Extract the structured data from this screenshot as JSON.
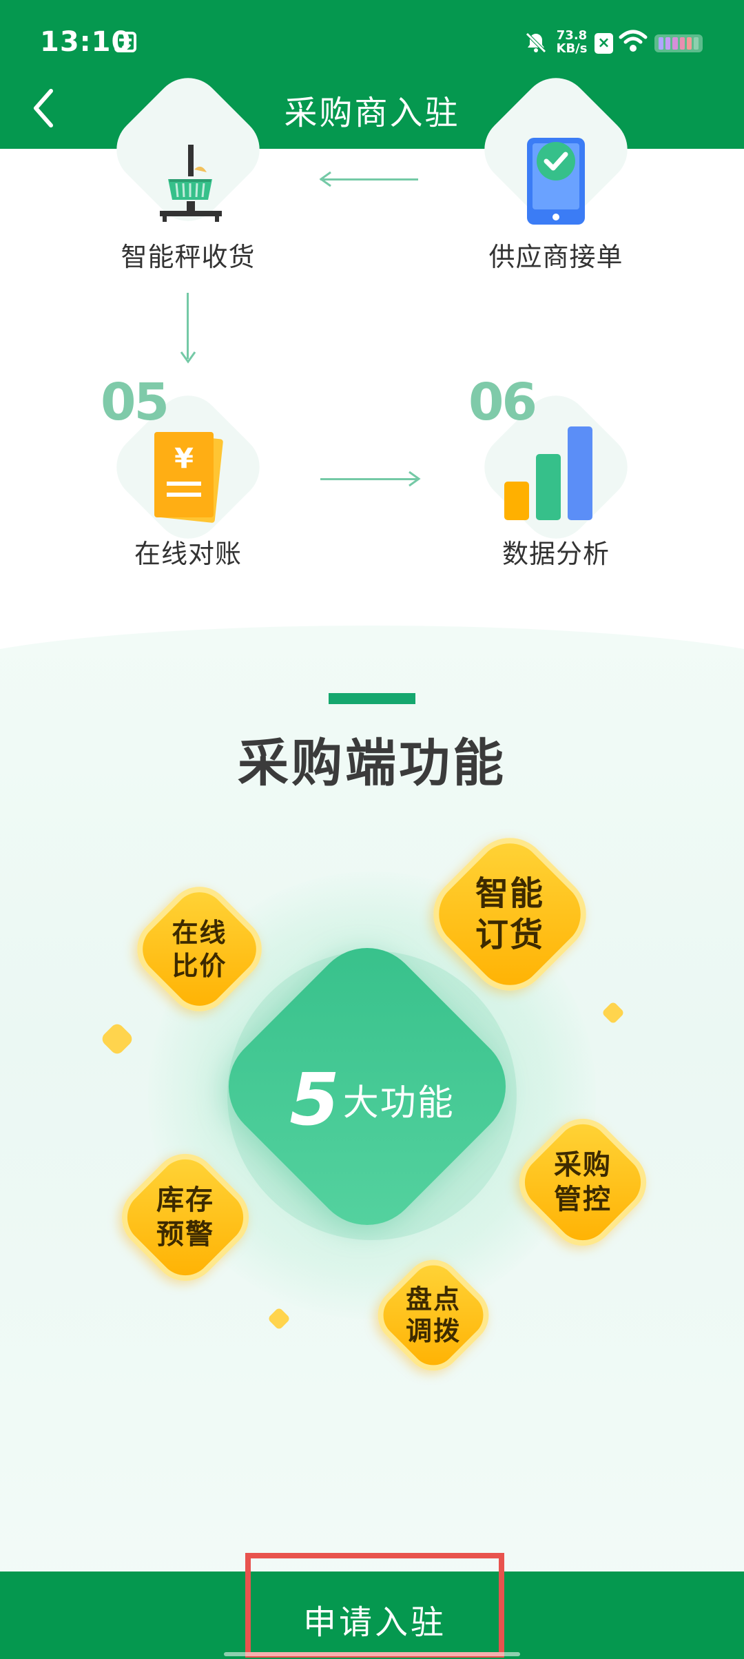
{
  "status_bar": {
    "time": "13:10",
    "speed_value": "73.8",
    "speed_unit": "KB/s"
  },
  "nav": {
    "title": "采购商入驻"
  },
  "flow": {
    "steps": [
      {
        "label": "智能秤收货"
      },
      {
        "label": "供应商接单"
      },
      {
        "num": "05",
        "label": "在线对账"
      },
      {
        "num": "06",
        "label": "数据分析"
      }
    ]
  },
  "features": {
    "title": "采购端功能",
    "center_num": "5",
    "center_label": "大功能",
    "items": [
      {
        "label": "在线比价",
        "line1": "在线",
        "line2": "比价"
      },
      {
        "label": "智能订货",
        "line1": "智能",
        "line2": "订货"
      },
      {
        "label": "库存预警",
        "line1": "库存",
        "line2": "预警"
      },
      {
        "label": "采购管控",
        "line1": "采购",
        "line2": "管控"
      },
      {
        "label": "盘点调拨",
        "line1": "盘点",
        "line2": "调拨"
      }
    ]
  },
  "action": {
    "apply_label": "申请入驻"
  },
  "colors": {
    "brand_green": "#05984f",
    "accent_gold": "#ffb000",
    "highlight_red": "#e8534e"
  }
}
